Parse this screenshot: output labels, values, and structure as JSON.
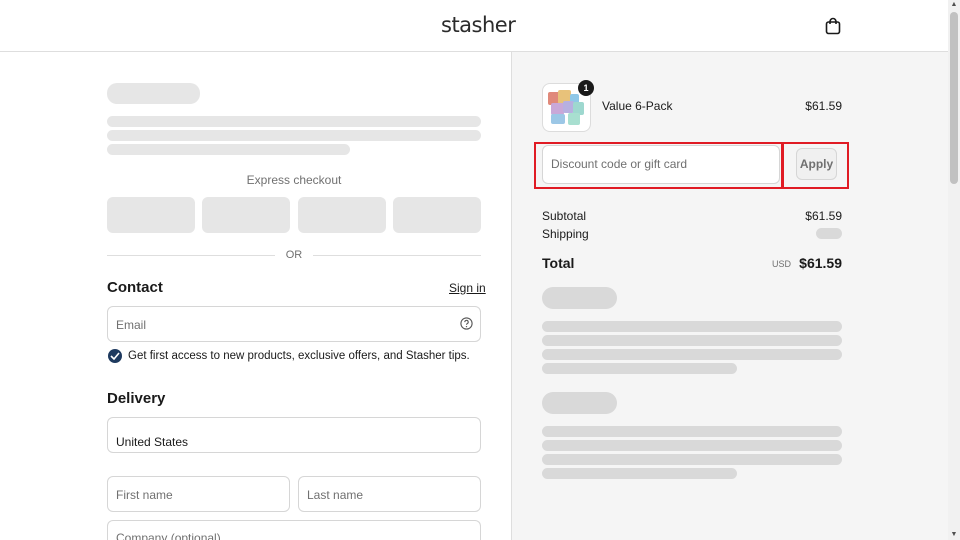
{
  "header": {
    "logo": "stasher",
    "cart_icon": "shopping-bag-icon"
  },
  "checkout": {
    "express_checkout_label": "Express checkout",
    "or_label": "OR",
    "contact": {
      "title": "Contact",
      "sign_in_label": "Sign in",
      "email_placeholder": "Email",
      "help_icon": "question-circle-icon",
      "marketing_opt_in_label": "Get first access to new products, exclusive offers, and Stasher tips.",
      "marketing_opt_in_checked": true
    },
    "delivery": {
      "title": "Delivery",
      "country_value": "United States",
      "first_name_placeholder": "First name",
      "last_name_placeholder": "Last name",
      "company_placeholder": "Company (optional)"
    }
  },
  "summary": {
    "product": {
      "name": "Value 6-Pack",
      "price": "$61.59",
      "quantity": "1"
    },
    "discount": {
      "placeholder": "Discount code or gift card",
      "apply_label": "Apply"
    },
    "subtotal_label": "Subtotal",
    "subtotal_value": "$61.59",
    "shipping_label": "Shipping",
    "total_label": "Total",
    "total_currency": "USD",
    "total_value": "$61.59"
  },
  "colors": {
    "checkbox": "#1e3a5f",
    "highlight": "#e01b24",
    "skeleton": "#e6e6e6",
    "summary_bg": "#f5f5f5"
  }
}
